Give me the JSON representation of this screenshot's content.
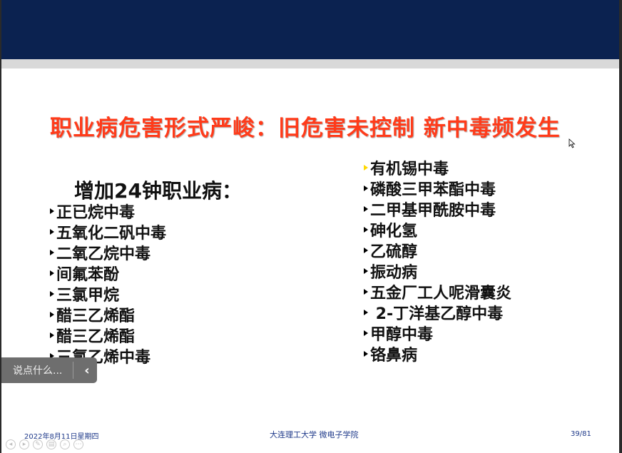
{
  "slide": {
    "title": "职业病危害形式严峻：旧危害未控制  新中毒频发生",
    "heading": "增加24钟职业病：",
    "left_items": [
      "正已烷中毒",
      "五氧化二矾中毒",
      "二氧乙烷中毒",
      "间氟苯酚",
      "三氯甲烷",
      "醋三乙烯酯",
      "醋三乙烯酯",
      "三氯乙烯中毒"
    ],
    "right_items": [
      "有机锡中毒",
      "磷酸三甲苯酯中毒",
      "二甲基甲酰胺中毒",
      "砷化氢",
      "乙硫醇",
      "振动病",
      "五金厂工人呢滑囊炎",
      " 2-丁洋基乙醇中毒",
      "甲醇中毒",
      "铬鼻病"
    ]
  },
  "comment": {
    "placeholder": "说点什么..."
  },
  "footer": {
    "date": "2022年8月11日星期四",
    "center": "大连理工大学  微电子学院",
    "page": "39/81"
  },
  "colors": {
    "title": "#ff3b1a",
    "banner": "#0b2250"
  }
}
